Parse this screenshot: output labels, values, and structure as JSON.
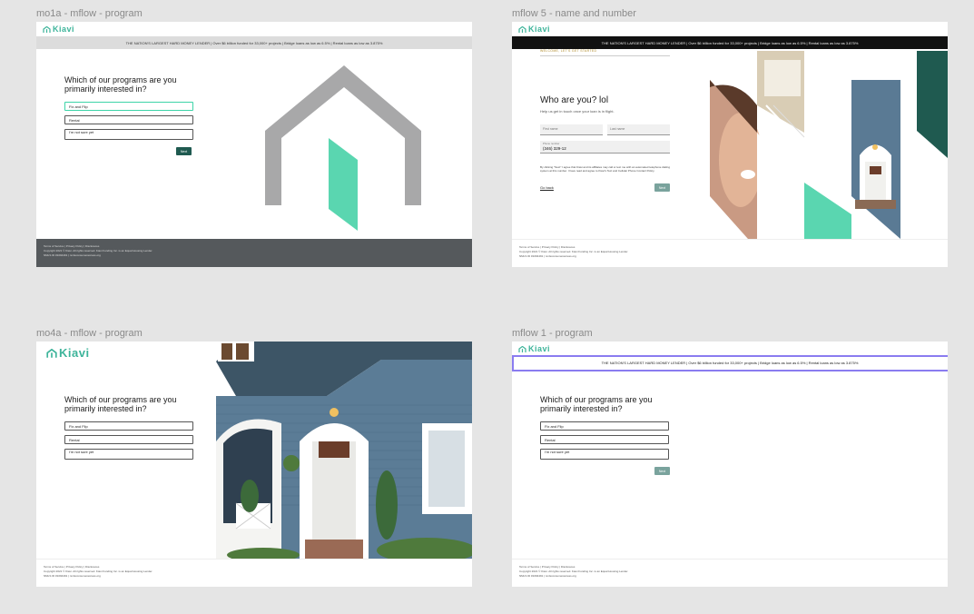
{
  "frames": {
    "f1": {
      "title": "mo1a - mflow - program",
      "logo": "Kiavi",
      "banner": "THE NATION'S LARGEST HARD MONEY LENDER | Over $6 billion funded for 33,000+ projects | Bridge loans as low as 6.5% | Rental loans as low as 3.875%",
      "question": "Which of our programs are you primarily interested in?",
      "options": [
        "Fix and Flip",
        "Rental",
        "I'm not sure yet"
      ],
      "next": "Next",
      "footer": {
        "links": "Terms of Service  |  Privacy Policy  |  Disclosures",
        "copyright": "Copyright 2021 © Kiavi. All rights reserved. Kiavi Funding Inc. is an Equal Housing Lender.",
        "nmls": "NMLS ID #1094491 | nmlsconsumeraccess.org"
      }
    },
    "f2": {
      "title": "mflow 5 - name and number",
      "logo": "Kiavi",
      "banner": "THE NATION'S LARGEST HARD MONEY LENDER | Over $6 billion funded for 33,000+ projects | Bridge loans as low as 6.5% | Rental loans as low as 3.875%",
      "welcome": "WELCOME, LET'S GET STARTED",
      "heading": "Who are you? lol",
      "help": "Help us get in touch once your loan is in flight.",
      "first_name_placeholder": "First name",
      "last_name_placeholder": "Last name",
      "phone_label": "Phone number",
      "phone_value": "(346) 329-12",
      "consent": "By clicking \"Next\" I agree that Kiavi and its affiliates may call or text me with an automated telephone dialing system at this number. I have read and agree to Kiavi's Text and Cellular Phone Contact Policy.",
      "go_back": "Go back",
      "next": "Next",
      "footer": {
        "links": "Terms of Service  |  Privacy Policy  |  Disclosures",
        "copyright": "Copyright 2021 © Kiavi. All rights reserved. Kiavi Funding Inc. is an Equal Housing Lender.",
        "nmls": "NMLS ID #1094491 | nmlsconsumeraccess.org"
      }
    },
    "f3": {
      "title": "mo4a - mflow - program",
      "logo": "Kiavi",
      "question": "Which of our programs are you primarily interested in?",
      "options": [
        "Fix and Flip",
        "Rental",
        "I'm not sure yet"
      ],
      "footer": {
        "links": "Terms of Service  |  Privacy Policy  |  Disclosures",
        "copyright": "Copyright 2021 © Kiavi. All rights reserved. Kiavi Funding Inc. is an Equal Housing Lender.",
        "nmls": "NMLS ID #1094491 | nmlsconsumeraccess.org"
      }
    },
    "f4": {
      "title": "mflow 1 - program",
      "logo": "Kiavi",
      "banner": "THE NATION'S LARGEST HARD MONEY LENDER | Over $6 billion funded for 33,000+ projects | Bridge loans as low as 6.5% | Rental loans as low as 3.875%",
      "question": "Which of our programs are you primarily interested in?",
      "options": [
        "Fix and Flip",
        "Rental",
        "I'm not sure yet"
      ],
      "next": "Next",
      "footer": {
        "links": "Terms of Service  |  Privacy Policy  |  Disclosures",
        "copyright": "Copyright 2021 © Kiavi. All rights reserved. Kiavi Funding Inc. is an Equal Housing Lender.",
        "nmls": "NMLS ID #1094491 | nmlsconsumeraccess.org"
      }
    }
  },
  "colors": {
    "brand": "#3db49a",
    "mint": "#5ad6b0",
    "dark_green": "#1f5a50",
    "gray_house": "#a8a8a9",
    "selection": "#8a7cf0"
  },
  "icons": [
    "kiavi-house-logo-icon"
  ]
}
